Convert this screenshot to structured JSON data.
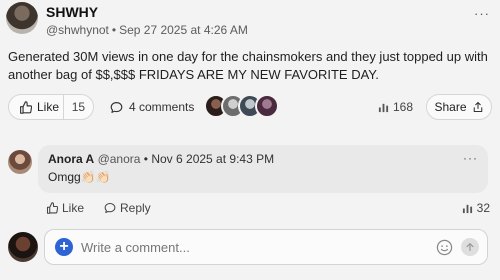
{
  "post": {
    "author_name": "SHWHY",
    "handle": "@shwhynot",
    "separator": "•",
    "timestamp": "Sep 27 2025 at 4:26 AM",
    "text": "Generated 30M views in one day for the chainsmokers and they just topped up with another bag of $$,$$$ FRIDAYS ARE MY NEW FAVORITE DAY.",
    "more_label": "···"
  },
  "actions": {
    "like_label": "Like",
    "like_count": "15",
    "comments_label": "4 comments",
    "views_count": "168",
    "share_label": "Share"
  },
  "comment": {
    "author_name": "Anora A",
    "handle": "@anora",
    "separator": "•",
    "timestamp": "Nov 6 2025 at 9:43 PM",
    "text": "Omgg👏🏻👏🏻",
    "more_label": "···",
    "like_label": "Like",
    "reply_label": "Reply",
    "views_count": "32"
  },
  "composer": {
    "placeholder": "Write a comment...",
    "plus_label": "+"
  },
  "colors": {
    "background": "#f3f3f3",
    "accent": "#2e63d6",
    "comment_bubble": "#e9e9e9"
  },
  "icons": [
    "thumbs-up-icon",
    "speech-bubble-icon",
    "bar-chart-icon",
    "share-icon",
    "more-icon",
    "plus-icon",
    "emoji-icon",
    "arrow-up-icon"
  ]
}
